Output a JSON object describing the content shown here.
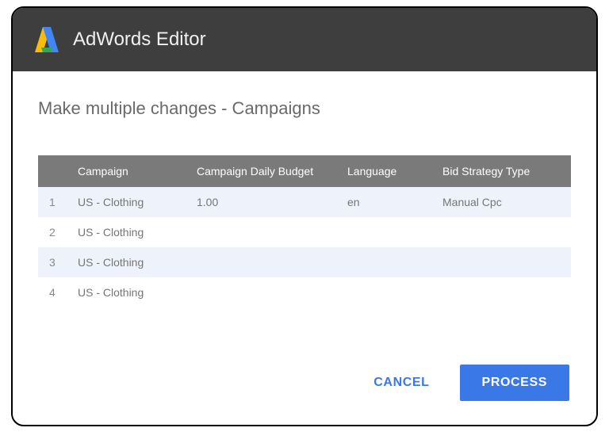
{
  "app": {
    "title": "AdWords Editor",
    "logo_alt": "adwords-logo"
  },
  "dialog": {
    "subtitle": "Make multiple changes - Campaigns"
  },
  "table": {
    "headers": {
      "num": "",
      "campaign": "Campaign",
      "budget": "Campaign Daily Budget",
      "language": "Language",
      "bid": "Bid Strategy Type"
    },
    "rows": [
      {
        "num": "1",
        "campaign": "US - Clothing",
        "budget": "1.00",
        "language": "en",
        "bid": "Manual Cpc"
      },
      {
        "num": "2",
        "campaign": "US - Clothing",
        "budget": "",
        "language": "",
        "bid": ""
      },
      {
        "num": "3",
        "campaign": "US - Clothing",
        "budget": "",
        "language": "",
        "bid": ""
      },
      {
        "num": "4",
        "campaign": "US - Clothing",
        "budget": "",
        "language": "",
        "bid": ""
      }
    ]
  },
  "actions": {
    "cancel": "CANCEL",
    "process": "PROCESS"
  }
}
